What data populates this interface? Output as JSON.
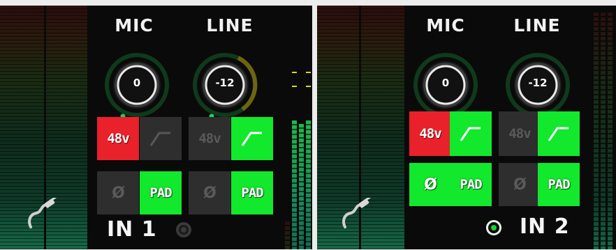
{
  "colors": {
    "phantom_active": "#e8212a",
    "active_green": "#12e82c",
    "off_gray": "#2e2e2e",
    "knob_arc_active": "#1f8a3a",
    "knob_arc_warn": "#8a7a10",
    "led_green": "#18d22c"
  },
  "icons": {
    "cable": "jack-cable-icon",
    "highpass": "highpass-filter-icon",
    "polarity": "phase-invert-icon",
    "select": "channel-select-led"
  },
  "channels": [
    {
      "name": "IN 1",
      "selected": false,
      "mic": {
        "label": "MIC",
        "gain": "0",
        "phantom": {
          "label": "48v",
          "on": true
        },
        "polarity": {
          "label": "Ø",
          "on": false
        }
      },
      "line": {
        "label": "LINE",
        "gain": "-12",
        "phantom": {
          "label": "48v",
          "on": false
        },
        "highpass_on": true,
        "pad": {
          "label": "PAD",
          "on": true
        }
      },
      "mic_highpass_on": false,
      "mic_pad": {
        "label": "PAD",
        "on": true
      },
      "line_polarity": {
        "label": "Ø",
        "on": false
      }
    },
    {
      "name": "IN 2",
      "selected": true,
      "mic": {
        "label": "MIC",
        "gain": "0",
        "phantom": {
          "label": "48v",
          "on": true
        },
        "polarity": {
          "label": "Ø",
          "on": true
        }
      },
      "line": {
        "label": "LINE",
        "gain": "-12",
        "phantom": {
          "label": "48v",
          "on": false
        },
        "highpass_on": true,
        "pad": {
          "label": "PAD",
          "on": true
        }
      },
      "mic_highpass_on": true,
      "mic_pad": {
        "label": "PAD",
        "on": true
      },
      "line_polarity": {
        "label": "Ø",
        "on": false
      }
    }
  ]
}
